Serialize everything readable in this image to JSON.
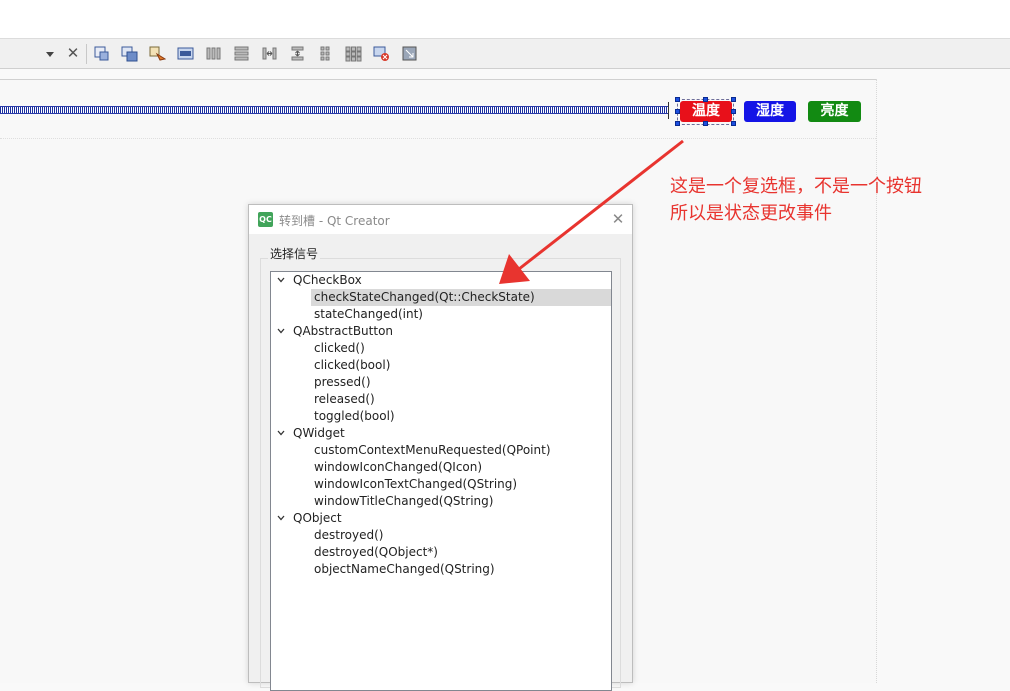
{
  "toolbar": {
    "icons": [
      "dropdown-arrow-icon",
      "close-icon",
      "edit-widgets-icon",
      "edit-signals-slots-icon",
      "edit-buddies-icon",
      "edit-tab-order-icon",
      "layout-horizontal-icon",
      "layout-vertical-icon",
      "layout-horizontal-splitter-icon",
      "layout-vertical-splitter-icon",
      "layout-form-icon",
      "layout-grid-icon",
      "break-layout-icon",
      "adjust-size-icon"
    ],
    "close_glyph": "✕"
  },
  "form": {
    "buttons": [
      {
        "label": "温度",
        "color": "#e8101a"
      },
      {
        "label": "湿度",
        "color": "#1414e6"
      },
      {
        "label": "亮度",
        "color": "#128a12"
      }
    ]
  },
  "annotation": {
    "line1": "这是一个复选框，不是一个按钮",
    "line2": "所以是状态更改事件",
    "color": "#e8342f"
  },
  "dialog": {
    "icon_label": "QC",
    "title": "转到槽 - Qt Creator",
    "close_glyph": "✕",
    "group_title": "选择信号",
    "groups": [
      {
        "name": "QCheckBox",
        "signals": [
          "checkStateChanged(Qt::CheckState)",
          "stateChanged(int)"
        ]
      },
      {
        "name": "QAbstractButton",
        "signals": [
          "clicked()",
          "clicked(bool)",
          "pressed()",
          "released()",
          "toggled(bool)"
        ]
      },
      {
        "name": "QWidget",
        "signals": [
          "customContextMenuRequested(QPoint)",
          "windowIconChanged(QIcon)",
          "windowIconTextChanged(QString)",
          "windowTitleChanged(QString)"
        ]
      },
      {
        "name": "QObject",
        "signals": [
          "destroyed()",
          "destroyed(QObject*)",
          "objectNameChanged(QString)"
        ]
      }
    ],
    "selected_signal": "checkStateChanged(Qt::CheckState)"
  }
}
